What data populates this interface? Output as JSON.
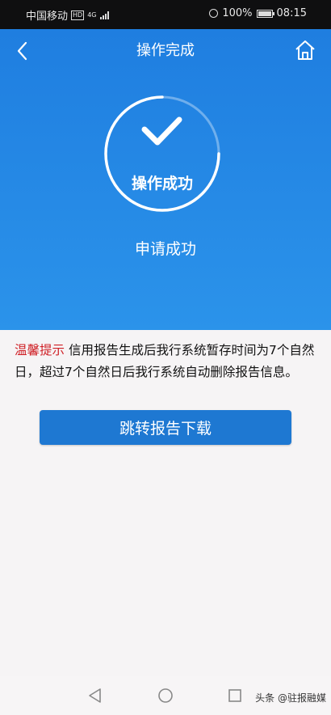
{
  "status_bar": {
    "carrier": "中国移动",
    "hd": "HD",
    "network": "4G",
    "battery": "100%",
    "time": "08:15"
  },
  "header": {
    "title": "操作完成",
    "back_icon": "chevron-left-icon",
    "home_icon": "home-icon"
  },
  "result": {
    "ring_label": "操作成功",
    "subtitle": "申请成功",
    "icon": "checkmark-icon"
  },
  "tip": {
    "label": "温馨提示",
    "text": "信用报告生成后我行系统暂存时间为7个自然日，超过7个自然日后我行系统自动删除报告信息。"
  },
  "actions": {
    "download_label": "跳转报告下载"
  },
  "watermark": "头条 @驻报融媒",
  "colors": {
    "primary": "#1e78d2",
    "tip_label": "#cf1f25",
    "hero_top": "#1f7ee0",
    "hero_bottom": "#2b93ea"
  }
}
